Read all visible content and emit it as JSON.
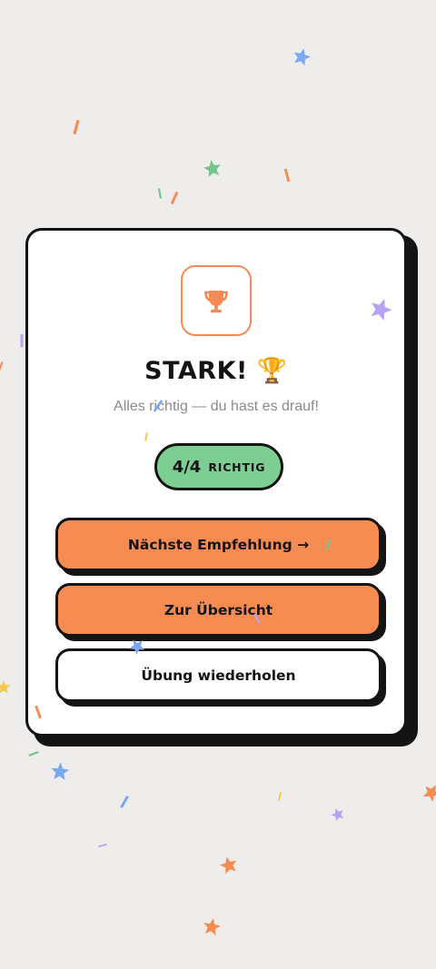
{
  "result": {
    "title": "STARK! 🏆",
    "subtitle": "Alles richtig — du hast es drauf!",
    "score_value": "4/4",
    "score_label": "RICHTIG"
  },
  "buttons": {
    "next_label": "Nächste Empfehlung →",
    "overview_label": "Zur Übersicht",
    "repeat_label": "Übung wiederholen"
  },
  "icons": {
    "card_icon": "trophy-icon"
  },
  "colors": {
    "background": "#efedeb",
    "accent_orange": "#f78c52",
    "success_green": "#7dce93",
    "text_dark": "#141414",
    "muted_text": "#8d8a87"
  }
}
